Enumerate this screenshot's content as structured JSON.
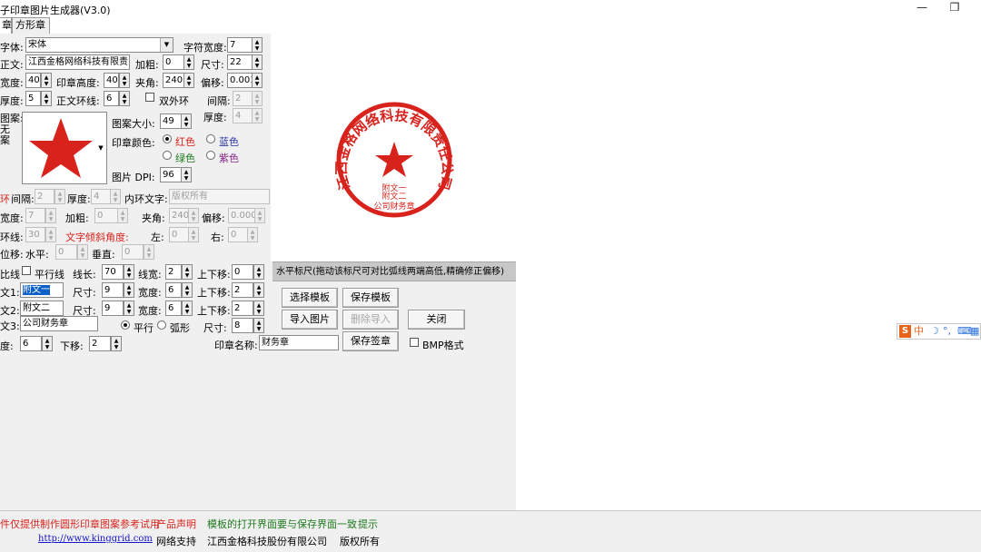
{
  "window": {
    "title": "子印章图片生成器(V3.0)",
    "minimize_glyph": "—",
    "restore_glyph": "❐"
  },
  "tabs": [
    {
      "label": "章"
    },
    {
      "label": "方形章"
    }
  ],
  "form": {
    "font_label": "字体:",
    "font_value": "宋体",
    "char_width_label": "字符宽度:",
    "char_width_value": "7",
    "body_label": "正文:",
    "body_value": "江西金格网络科技有限责",
    "bold_label": "加粗:",
    "bold_value": "0",
    "size_label": "尺寸:",
    "size_value": "22",
    "width_label": "宽度:",
    "width_value": "40",
    "height_label": "印章高度:",
    "height_value": "40",
    "angle_label": "夹角:",
    "angle_value": "240",
    "offset_label": "偏移:",
    "offset_value": "0.001",
    "thickness_label": "厚度:",
    "thickness_value": "5",
    "ring_label": "正文环线:",
    "ring_value": "6",
    "double_ring_label": "双外环",
    "gap_label": "间隔:",
    "gap_value": "2",
    "pattern_label": "图案:",
    "pattern_none_label": "无\n案",
    "thickness2_label": "厚度:",
    "thickness2_value": "4",
    "pattern_size_label": "图案大小:",
    "pattern_size_value": "49",
    "stamp_color_label": "印章颜色:",
    "color_red": "红色",
    "color_blue": "蓝色",
    "color_green": "绿色",
    "color_purple": "紫色",
    "dpi_label": "图片 DPI:",
    "dpi_value": "96",
    "inner_ring_label": "环",
    "inner_gap_label": "间隔:",
    "inner_gap_value": "2",
    "inner_thickness_label": "厚度:",
    "inner_thickness_value": "4",
    "inner_text_label": "内环文字:",
    "inner_text_placeholder": "版权所有",
    "inner_width_label": "宽度:",
    "inner_width_value": "7",
    "inner_bold_label": "加粗:",
    "inner_bold_value": "0",
    "inner_angle_label": "夹角:",
    "inner_angle_value": "240",
    "inner_offset_label": "偏移:",
    "inner_offset_value": "0.000",
    "inner_ring_line_label": "环线:",
    "inner_ring_line_value": "30",
    "tilt_label": "文字倾斜角度:",
    "tilt_left_label": "左:",
    "tilt_left_value": "0",
    "tilt_right_label": "右:",
    "tilt_right_value": "0",
    "shift_label": "位移:",
    "shift_h_label": "水平:",
    "shift_h_value": "0",
    "shift_v_label": "垂直:",
    "shift_v_value": "0",
    "compare_label": "比线",
    "parallel_label": "平行线",
    "line_len_label": "线长:",
    "line_len_value": "70",
    "line_width_label": "线宽:",
    "line_width_value": "2",
    "updown_label": "上下移:",
    "updown_value": "0",
    "sub1_label": "文1:",
    "sub1_value": "附文一",
    "sub1_size_label": "尺寸:",
    "sub1_size_value": "9",
    "sub1_width_label": "宽度:",
    "sub1_width_value": "6",
    "sub1_updown_label": "上下移:",
    "sub1_updown_value": "2",
    "sub2_label": "文2:",
    "sub2_value": "附文二",
    "sub2_size_label": "尺寸:",
    "sub2_size_value": "9",
    "sub2_width_label": "宽度:",
    "sub2_width_value": "6",
    "sub2_updown_label": "上下移:",
    "sub2_updown_value": "2",
    "sub3_label": "文3:",
    "sub3_value": "公司财务章",
    "parallel_radio": "平行",
    "arc_radio": "弧形",
    "sub3_size_label": "尺寸:",
    "sub3_size_value": "8",
    "degree_label": "度:",
    "degree_value": "6",
    "down_label": "下移:",
    "down_value": "2",
    "stamp_name_label": "印章名称:",
    "stamp_name_value": "财务章",
    "bmp_label": "BMP格式"
  },
  "buttons": {
    "select_template": "选择模板",
    "save_template": "保存模板",
    "import_image": "导入图片",
    "delete_import": "删除导入",
    "close": "关闭",
    "save_stamp": "保存签章"
  },
  "preview": {
    "ring_text": "江西金格网络科技有限责任公司",
    "sub1": "附文一",
    "sub2": "附文二",
    "sub3": "公司财务章",
    "stamp_color": "#d8231d"
  },
  "ruler_text": "水平标尺(拖动该标尺可对比弧线两端高低,精确修正偏移)",
  "footer": {
    "disclaimer": "件仅提供制作圆形印章图案参考试用",
    "product_statement": "产品声明",
    "template_hint": "模板的打开界面要与保存界面一致",
    "tip": "提示",
    "url": "http://www.kinggrid.com",
    "network_support": "网络支持",
    "company": "江西金格科技股份有限公司",
    "copyright": "版权所有"
  },
  "ime": {
    "logo": "S",
    "mode": "中",
    "moon": "☽",
    "punct": "°,",
    "keyboard": "⌨",
    "shirt": "▦"
  },
  "colors": {
    "stamp_red": "#d8231d",
    "link_blue": "#1414c8",
    "footer_green": "#1e7a1e",
    "ime_orange": "#e8641a",
    "ime_blue": "#2a6fd8"
  }
}
